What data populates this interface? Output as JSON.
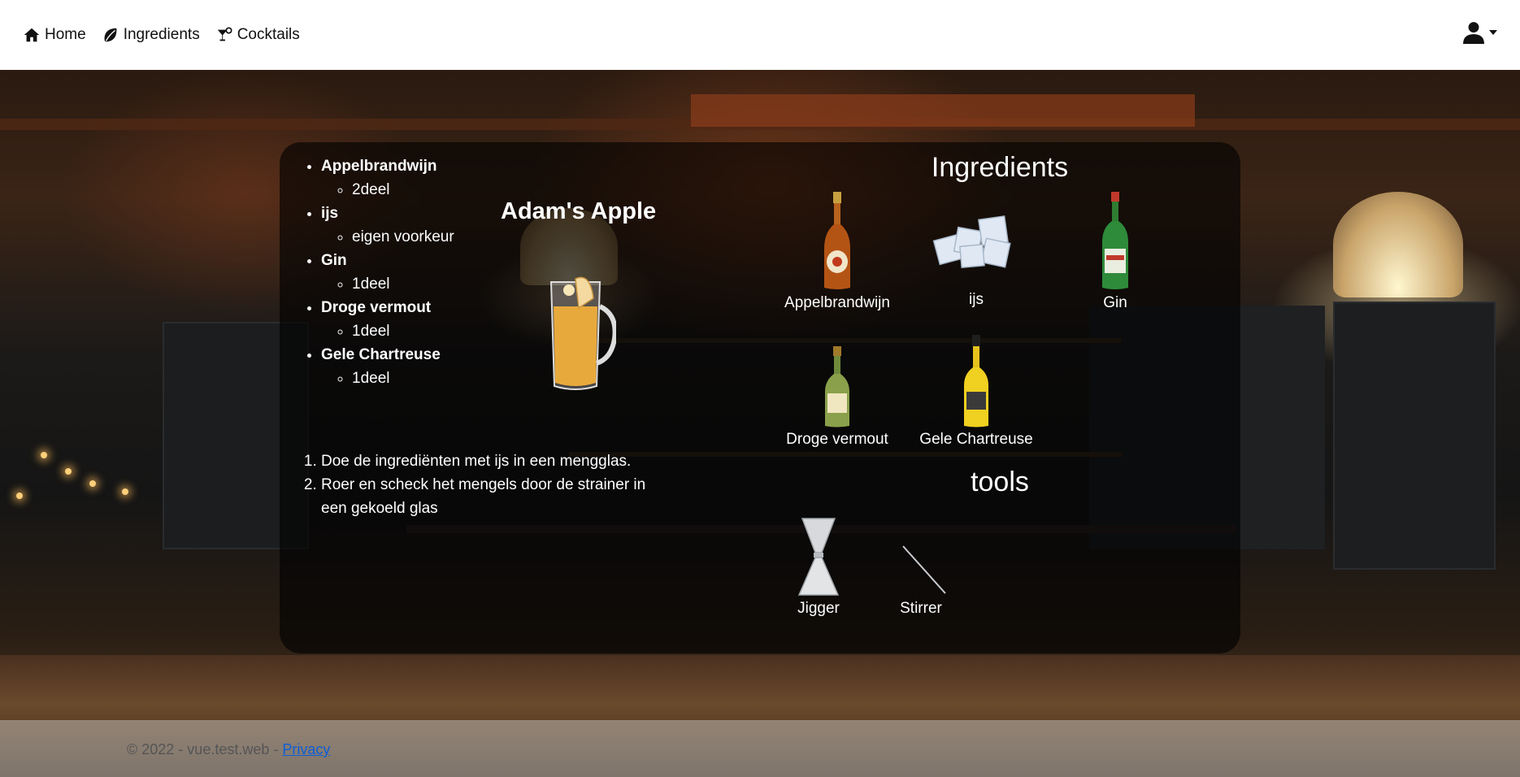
{
  "nav": {
    "home": "Home",
    "ingredients": "Ingredients",
    "cocktails": "Cocktails"
  },
  "cocktail": {
    "title": "Adam's Apple",
    "ingredients": [
      {
        "name": "Appelbrandwijn",
        "amount": "2deel"
      },
      {
        "name": "ijs",
        "amount": "eigen voorkeur"
      },
      {
        "name": "Gin",
        "amount": "1deel"
      },
      {
        "name": "Droge vermout",
        "amount": "1deel"
      },
      {
        "name": "Gele Chartreuse",
        "amount": "1deel"
      }
    ],
    "steps": [
      "Doe de ingrediënten met ijs in een mengglas.",
      "Roer en scheck het mengels door de strainer in een gekoeld glas"
    ]
  },
  "ingredients_section": {
    "title": "Ingredients",
    "items": [
      "Appelbrandwijn",
      "ijs",
      "Gin",
      "Droge vermout",
      "Gele Chartreuse"
    ]
  },
  "tools_section": {
    "title": "tools",
    "items": [
      "Jigger",
      "Stirrer"
    ]
  },
  "footer": {
    "copyright": "© 2022 - vue.test.web - ",
    "privacy": "Privacy"
  }
}
